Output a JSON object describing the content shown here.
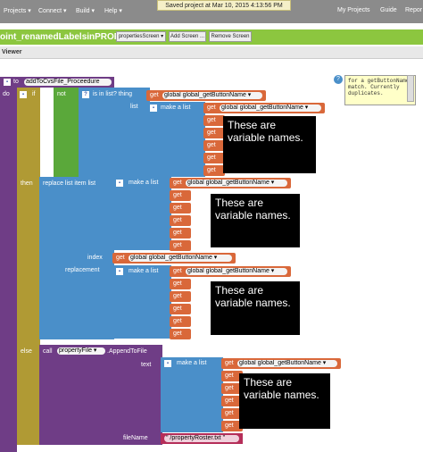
{
  "menu": {
    "projects": "Projects ▾",
    "connect": "Connect ▾",
    "build": "Build ▾",
    "help": "Help ▾",
    "my_projects": "My Projects",
    "guide": "Guide",
    "report": "Repor"
  },
  "toast": "Saved project at Mar 10, 2015 4:13:56 PM",
  "project": {
    "name": "oint_renamedLabelsinPROPS",
    "screen_select": "propertiesScreen ▾",
    "add_screen": "Add Screen ...",
    "remove_screen": "Remove Screen"
  },
  "viewer_label": "Viewer",
  "comment": {
    "icon": "?",
    "text": "for a getButtonName match. Currently duplicates."
  },
  "blocks": {
    "to": "to",
    "proc_name": "addToCvsFile_Proceedure",
    "do": "do",
    "if": "if",
    "not": "not",
    "is_in_list": "is in list? thing",
    "list": "list",
    "make_a_list": "make a list",
    "get": "get",
    "global_button": "global global_getButtonName ▾",
    "then": "then",
    "replace": "replace list item  list",
    "index": "index",
    "replacement": "replacement",
    "global_button2": "global global_getButtonName ▾",
    "else": "else",
    "call": "call",
    "property_file": "propertyFile ▾",
    "append": ".AppendToFile",
    "text": "text",
    "filename": "fileName",
    "filename_value": "\" /propertyRoster.txt \""
  },
  "notes": {
    "n1": "These are variable names.",
    "n2": "These are variable names.",
    "n3": "These are variable names.",
    "n4": "These are variable names."
  }
}
